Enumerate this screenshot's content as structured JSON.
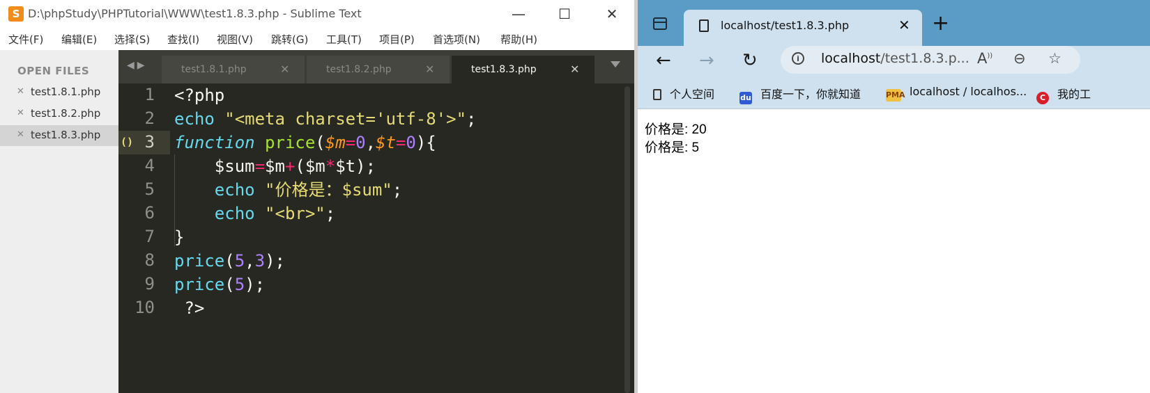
{
  "sublime": {
    "window_title": "D:\\phpStudy\\PHPTutorial\\WWW\\test1.8.3.php - Sublime Text",
    "menu": [
      "文件(F)",
      "编辑(E)",
      "选择(S)",
      "查找(I)",
      "视图(V)",
      "跳转(G)",
      "工具(T)",
      "项目(P)",
      "首选项(N)",
      "帮助(H)"
    ],
    "sidebar_header": "OPEN FILES",
    "open_files": [
      "test1.8.1.php",
      "test1.8.2.php",
      "test1.8.3.php"
    ],
    "tabs": [
      "test1.8.1.php",
      "test1.8.2.php",
      "test1.8.3.php"
    ],
    "active_tab": "test1.8.3.php",
    "line_numbers": [
      "1",
      "2",
      "3",
      "4",
      "5",
      "6",
      "7",
      "8",
      "9",
      "10"
    ]
  },
  "browser": {
    "tab_title": "localhost/test1.8.3.php",
    "address_host": "localhost",
    "address_rest": "/test1.8.3.p...",
    "bookmarks": [
      "个人空间",
      "百度一下，你就知道",
      "localhost / localhos...",
      "我的工"
    ],
    "output": [
      "价格是: 20",
      "价格是: 5"
    ]
  },
  "colors": {
    "editor_bg": "#272822",
    "browser_accent": "#5a9cc6"
  }
}
